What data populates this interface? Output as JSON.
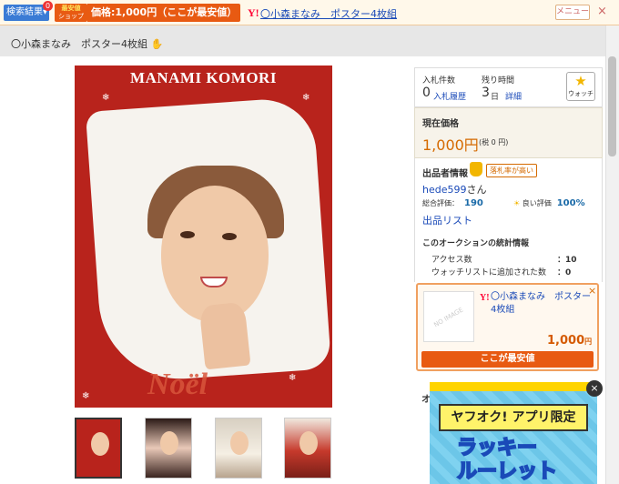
{
  "topbar": {
    "search_label": "検索結果▾",
    "badge_count": "0",
    "cheap_logo_line1": "最安値",
    "cheap_logo_line2": "ショップ",
    "price_text": "価格:1,000円（ここが最安値）",
    "y_logo": "Y!",
    "link_text": "〇小森まなみ　ポスター4枚組",
    "menu_label": "メニュー",
    "close": "×"
  },
  "item": {
    "title": "〇小森まなみ　ポスター4枚組",
    "title_icon": "hand-icon"
  },
  "poster": {
    "heading": "MANAMI KOMORI",
    "script_text": "Noël"
  },
  "stats": {
    "bids_label": "入札件数",
    "bids_value": "0",
    "bids_link": "入札履歴",
    "time_label": "残り時間",
    "time_value": "3",
    "time_unit": "日",
    "time_link": "詳細",
    "watch_label": "ウォッチ"
  },
  "price": {
    "heading": "現在価格",
    "value": "1,000円",
    "tax": "(税 0 円)"
  },
  "seller": {
    "heading": "出品者情報",
    "badge": "落札率が高い",
    "name": "hede599",
    "name_suffix": "さん",
    "total_label": "総合評価：",
    "total_value": "190",
    "good_label": "良い評価",
    "good_value": "100%",
    "list_link": "出品リスト"
  },
  "auction_stats": {
    "heading": "このオークションの統計情報",
    "access_label": "アクセス数",
    "access_value": "：10",
    "watch_label": "ウォッチリストに追加された数",
    "watch_value": "：0"
  },
  "popup": {
    "noimage": "NO IMAGE",
    "y_logo": "Y!",
    "title": "〇小森まなみ　ポスター4枚組",
    "price": "1,000",
    "price_unit": "円",
    "button": "ここが最安値",
    "close": "×"
  },
  "ad": {
    "tag": "ヤフオク! アプリ限定",
    "line1": "ラッキー",
    "line2": "ルーレット",
    "close": "×"
  },
  "fragment": "オ"
}
